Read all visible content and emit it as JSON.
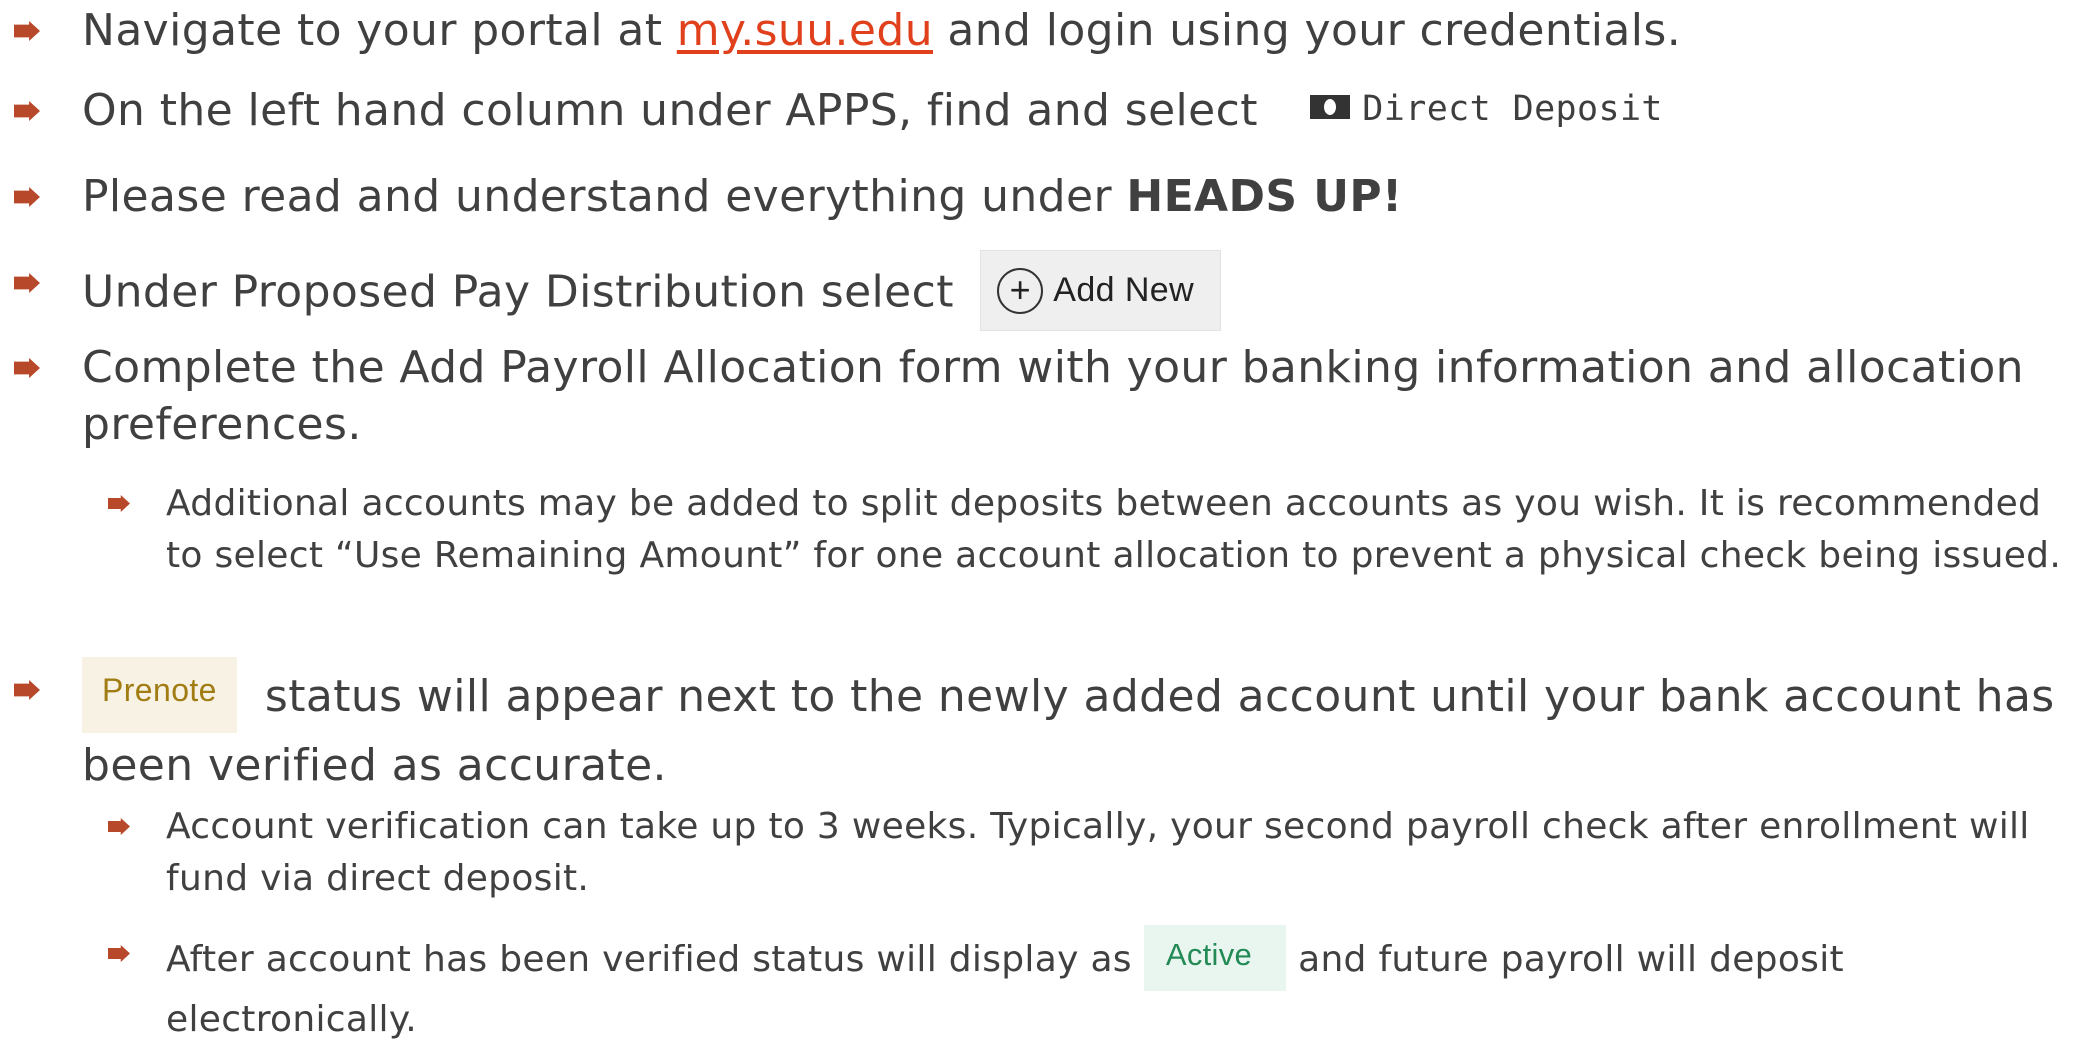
{
  "steps": [
    {
      "pre": "Navigate to your portal at ",
      "link": "my.suu.edu",
      "post": " and login using your credentials."
    },
    {
      "text": "On the left hand column under APPS, find and select",
      "chip_label": "Direct Deposit",
      "chip_icon": "cash-icon"
    },
    {
      "pre": "Please read and understand everything under ",
      "bold": "HEADS UP!"
    },
    {
      "text": "Under Proposed Pay Distribution select",
      "button_label": "Add New",
      "button_icon": "plus-circle-icon"
    },
    {
      "text": "Complete the Add Payroll Allocation form with your banking information and allocation preferences."
    },
    {
      "text": "Additional accounts may be added to split deposits between accounts as you wish.  It is recommended to select “Use Remaining Amount” for one account allocation to prevent a physical check being issued."
    },
    {
      "badge": "Prenote",
      "text": "status will appear next to the newly added account until your bank account has been verified as accurate."
    },
    {
      "text": "Account verification can take up to 3 weeks. Typically, your second payroll check after enrollment will fund via direct deposit."
    },
    {
      "pre": "After account has been verified status will display as",
      "badge": "Active",
      "post": "and future payroll will deposit electronically."
    }
  ],
  "colors": {
    "bullet": "#b8482a",
    "link": "#e0401c",
    "text": "#404040",
    "prenote_bg": "#f7f2e3",
    "prenote_text": "#a07c12",
    "active_bg": "#e8f6ef",
    "active_text": "#238a56"
  }
}
